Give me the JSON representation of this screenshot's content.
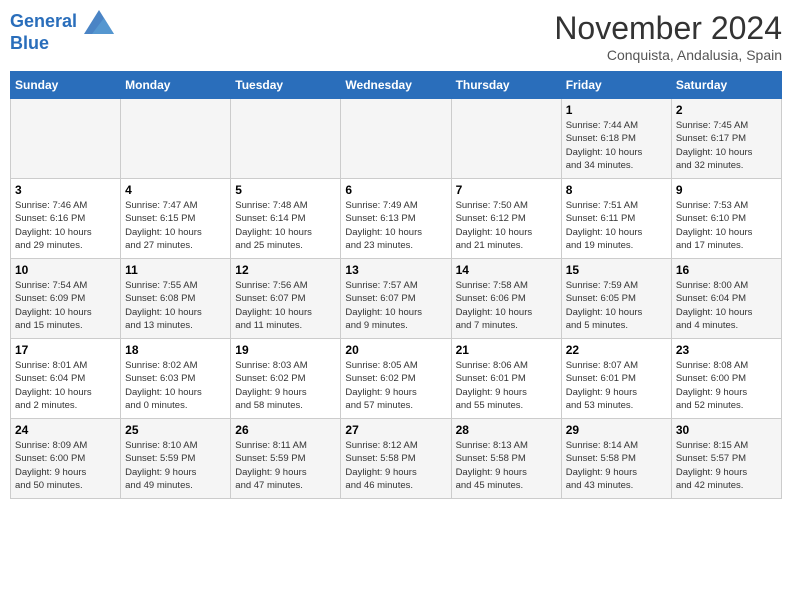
{
  "logo": {
    "line1": "General",
    "line2": "Blue"
  },
  "title": "November 2024",
  "subtitle": "Conquista, Andalusia, Spain",
  "days_of_week": [
    "Sunday",
    "Monday",
    "Tuesday",
    "Wednesday",
    "Thursday",
    "Friday",
    "Saturday"
  ],
  "weeks": [
    [
      {
        "day": "",
        "info": ""
      },
      {
        "day": "",
        "info": ""
      },
      {
        "day": "",
        "info": ""
      },
      {
        "day": "",
        "info": ""
      },
      {
        "day": "",
        "info": ""
      },
      {
        "day": "1",
        "info": "Sunrise: 7:44 AM\nSunset: 6:18 PM\nDaylight: 10 hours\nand 34 minutes."
      },
      {
        "day": "2",
        "info": "Sunrise: 7:45 AM\nSunset: 6:17 PM\nDaylight: 10 hours\nand 32 minutes."
      }
    ],
    [
      {
        "day": "3",
        "info": "Sunrise: 7:46 AM\nSunset: 6:16 PM\nDaylight: 10 hours\nand 29 minutes."
      },
      {
        "day": "4",
        "info": "Sunrise: 7:47 AM\nSunset: 6:15 PM\nDaylight: 10 hours\nand 27 minutes."
      },
      {
        "day": "5",
        "info": "Sunrise: 7:48 AM\nSunset: 6:14 PM\nDaylight: 10 hours\nand 25 minutes."
      },
      {
        "day": "6",
        "info": "Sunrise: 7:49 AM\nSunset: 6:13 PM\nDaylight: 10 hours\nand 23 minutes."
      },
      {
        "day": "7",
        "info": "Sunrise: 7:50 AM\nSunset: 6:12 PM\nDaylight: 10 hours\nand 21 minutes."
      },
      {
        "day": "8",
        "info": "Sunrise: 7:51 AM\nSunset: 6:11 PM\nDaylight: 10 hours\nand 19 minutes."
      },
      {
        "day": "9",
        "info": "Sunrise: 7:53 AM\nSunset: 6:10 PM\nDaylight: 10 hours\nand 17 minutes."
      }
    ],
    [
      {
        "day": "10",
        "info": "Sunrise: 7:54 AM\nSunset: 6:09 PM\nDaylight: 10 hours\nand 15 minutes."
      },
      {
        "day": "11",
        "info": "Sunrise: 7:55 AM\nSunset: 6:08 PM\nDaylight: 10 hours\nand 13 minutes."
      },
      {
        "day": "12",
        "info": "Sunrise: 7:56 AM\nSunset: 6:07 PM\nDaylight: 10 hours\nand 11 minutes."
      },
      {
        "day": "13",
        "info": "Sunrise: 7:57 AM\nSunset: 6:07 PM\nDaylight: 10 hours\nand 9 minutes."
      },
      {
        "day": "14",
        "info": "Sunrise: 7:58 AM\nSunset: 6:06 PM\nDaylight: 10 hours\nand 7 minutes."
      },
      {
        "day": "15",
        "info": "Sunrise: 7:59 AM\nSunset: 6:05 PM\nDaylight: 10 hours\nand 5 minutes."
      },
      {
        "day": "16",
        "info": "Sunrise: 8:00 AM\nSunset: 6:04 PM\nDaylight: 10 hours\nand 4 minutes."
      }
    ],
    [
      {
        "day": "17",
        "info": "Sunrise: 8:01 AM\nSunset: 6:04 PM\nDaylight: 10 hours\nand 2 minutes."
      },
      {
        "day": "18",
        "info": "Sunrise: 8:02 AM\nSunset: 6:03 PM\nDaylight: 10 hours\nand 0 minutes."
      },
      {
        "day": "19",
        "info": "Sunrise: 8:03 AM\nSunset: 6:02 PM\nDaylight: 9 hours\nand 58 minutes."
      },
      {
        "day": "20",
        "info": "Sunrise: 8:05 AM\nSunset: 6:02 PM\nDaylight: 9 hours\nand 57 minutes."
      },
      {
        "day": "21",
        "info": "Sunrise: 8:06 AM\nSunset: 6:01 PM\nDaylight: 9 hours\nand 55 minutes."
      },
      {
        "day": "22",
        "info": "Sunrise: 8:07 AM\nSunset: 6:01 PM\nDaylight: 9 hours\nand 53 minutes."
      },
      {
        "day": "23",
        "info": "Sunrise: 8:08 AM\nSunset: 6:00 PM\nDaylight: 9 hours\nand 52 minutes."
      }
    ],
    [
      {
        "day": "24",
        "info": "Sunrise: 8:09 AM\nSunset: 6:00 PM\nDaylight: 9 hours\nand 50 minutes."
      },
      {
        "day": "25",
        "info": "Sunrise: 8:10 AM\nSunset: 5:59 PM\nDaylight: 9 hours\nand 49 minutes."
      },
      {
        "day": "26",
        "info": "Sunrise: 8:11 AM\nSunset: 5:59 PM\nDaylight: 9 hours\nand 47 minutes."
      },
      {
        "day": "27",
        "info": "Sunrise: 8:12 AM\nSunset: 5:58 PM\nDaylight: 9 hours\nand 46 minutes."
      },
      {
        "day": "28",
        "info": "Sunrise: 8:13 AM\nSunset: 5:58 PM\nDaylight: 9 hours\nand 45 minutes."
      },
      {
        "day": "29",
        "info": "Sunrise: 8:14 AM\nSunset: 5:58 PM\nDaylight: 9 hours\nand 43 minutes."
      },
      {
        "day": "30",
        "info": "Sunrise: 8:15 AM\nSunset: 5:57 PM\nDaylight: 9 hours\nand 42 minutes."
      }
    ]
  ]
}
